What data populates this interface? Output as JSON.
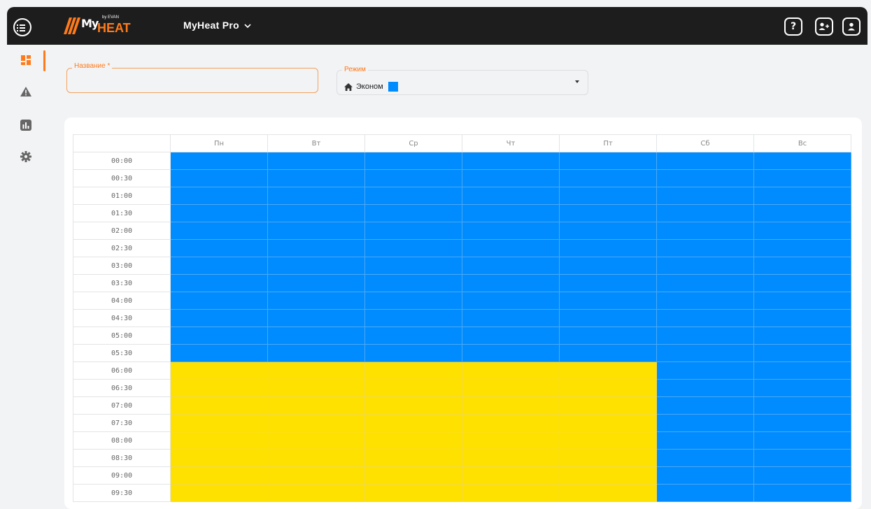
{
  "app": {
    "logo_my": "My",
    "logo_by": "by EVAN",
    "logo_heat": "HEAT",
    "product_name": "MyHeat Pro"
  },
  "topbar_icons": [
    "menu-icon",
    "help-icon",
    "add-user-icon",
    "user-icon"
  ],
  "sidebar": {
    "items": [
      {
        "icon": "dashboard-icon",
        "active": true
      },
      {
        "icon": "warning-icon",
        "active": false
      },
      {
        "icon": "chart-icon",
        "active": false
      },
      {
        "icon": "gear-icon",
        "active": false
      }
    ]
  },
  "form": {
    "name_label": "Название *",
    "name_value": "",
    "mode_label": "Режим",
    "mode_value": "Эконом",
    "mode_icon": "home-icon"
  },
  "colors": {
    "accent": "#ff7a1a",
    "econom": "#008cff",
    "comfort": "#ffe100"
  },
  "schedule": {
    "days": [
      "Пн",
      "Вт",
      "Ср",
      "Чт",
      "Пт",
      "Сб",
      "Вс"
    ],
    "rows": [
      {
        "time": "00:00",
        "modes": [
          "econom",
          "econom",
          "econom",
          "econom",
          "econom",
          "econom",
          "econom"
        ]
      },
      {
        "time": "00:30",
        "modes": [
          "econom",
          "econom",
          "econom",
          "econom",
          "econom",
          "econom",
          "econom"
        ]
      },
      {
        "time": "01:00",
        "modes": [
          "econom",
          "econom",
          "econom",
          "econom",
          "econom",
          "econom",
          "econom"
        ]
      },
      {
        "time": "01:30",
        "modes": [
          "econom",
          "econom",
          "econom",
          "econom",
          "econom",
          "econom",
          "econom"
        ]
      },
      {
        "time": "02:00",
        "modes": [
          "econom",
          "econom",
          "econom",
          "econom",
          "econom",
          "econom",
          "econom"
        ]
      },
      {
        "time": "02:30",
        "modes": [
          "econom",
          "econom",
          "econom",
          "econom",
          "econom",
          "econom",
          "econom"
        ]
      },
      {
        "time": "03:00",
        "modes": [
          "econom",
          "econom",
          "econom",
          "econom",
          "econom",
          "econom",
          "econom"
        ]
      },
      {
        "time": "03:30",
        "modes": [
          "econom",
          "econom",
          "econom",
          "econom",
          "econom",
          "econom",
          "econom"
        ]
      },
      {
        "time": "04:00",
        "modes": [
          "econom",
          "econom",
          "econom",
          "econom",
          "econom",
          "econom",
          "econom"
        ]
      },
      {
        "time": "04:30",
        "modes": [
          "econom",
          "econom",
          "econom",
          "econom",
          "econom",
          "econom",
          "econom"
        ]
      },
      {
        "time": "05:00",
        "modes": [
          "econom",
          "econom",
          "econom",
          "econom",
          "econom",
          "econom",
          "econom"
        ]
      },
      {
        "time": "05:30",
        "modes": [
          "econom",
          "econom",
          "econom",
          "econom",
          "econom",
          "econom",
          "econom"
        ]
      },
      {
        "time": "06:00",
        "modes": [
          "comfort",
          "comfort",
          "comfort",
          "comfort",
          "comfort",
          "econom",
          "econom"
        ]
      },
      {
        "time": "06:30",
        "modes": [
          "comfort",
          "comfort",
          "comfort",
          "comfort",
          "comfort",
          "econom",
          "econom"
        ]
      },
      {
        "time": "07:00",
        "modes": [
          "comfort",
          "comfort",
          "comfort",
          "comfort",
          "comfort",
          "econom",
          "econom"
        ]
      },
      {
        "time": "07:30",
        "modes": [
          "comfort",
          "comfort",
          "comfort",
          "comfort",
          "comfort",
          "econom",
          "econom"
        ]
      },
      {
        "time": "08:00",
        "modes": [
          "comfort",
          "comfort",
          "comfort",
          "comfort",
          "comfort",
          "econom",
          "econom"
        ]
      },
      {
        "time": "08:30",
        "modes": [
          "comfort",
          "comfort",
          "comfort",
          "comfort",
          "comfort",
          "econom",
          "econom"
        ]
      },
      {
        "time": "09:00",
        "modes": [
          "comfort",
          "comfort",
          "comfort",
          "comfort",
          "comfort",
          "econom",
          "econom"
        ]
      },
      {
        "time": "09:30",
        "modes": [
          "comfort",
          "comfort",
          "comfort",
          "comfort",
          "comfort",
          "econom",
          "econom"
        ]
      }
    ]
  }
}
